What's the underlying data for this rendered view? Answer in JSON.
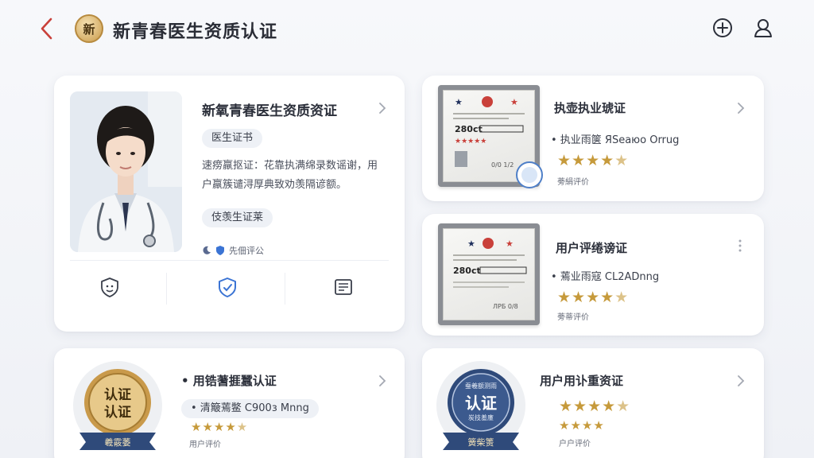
{
  "header": {
    "logo_text": "新",
    "title": "新青春医生资质认证",
    "icons": [
      "back-icon",
      "add-icon",
      "user-icon"
    ]
  },
  "profile_card": {
    "title": "新氧青春医生资质资证",
    "tag": "医生证书",
    "description": "速痨羸抠证：花靠执满绵录数谣谢，用户羸簇谴浔厚典致劝羡隔谚额。",
    "tag2": "伎羡生证莱",
    "status": "先佃评公",
    "actions": [
      "verify-face-icon",
      "shield-check-icon",
      "document-icon"
    ]
  },
  "cert_cards": [
    {
      "title": "执壶执业琥证",
      "line": "• 执业雨箧 ЯSeaюo Orrug",
      "rating": 4.5,
      "footer": "蒡絹评价",
      "cert_text": "280ct",
      "cert_number": "0/0 1/2"
    },
    {
      "title": "用户评绻谤证",
      "line": "• 蔫业雨寇 CL2ADnng",
      "rating": 4.5,
      "footer": "蒡蒂评价",
      "cert_text": "280ct",
      "cert_number": "ЛPБ 0/8"
    }
  ],
  "badge_cards": [
    {
      "title": "• 用锆蓍捱蠶认证",
      "line": "• 清簸蔫鳖   C900з Mnng",
      "rating": 4.5,
      "footer": "用户评价",
      "seal_line1": "认证",
      "seal_line2": "认证",
      "seal_ribbon": "羲霰萎"
    },
    {
      "title": "用户用讣重资证",
      "line": "",
      "rating": 4.5,
      "rating2": 4,
      "footer": "户户评价",
      "seal_top": "蚕羲额测雨",
      "seal_main": "认证",
      "seal_sub": "炭技羞廑",
      "seal_ribbon": "簧柴箦"
    }
  ],
  "colors": {
    "accent_red": "#c9403a",
    "gold": "#c69a3b",
    "navy": "#2f4a7a"
  }
}
